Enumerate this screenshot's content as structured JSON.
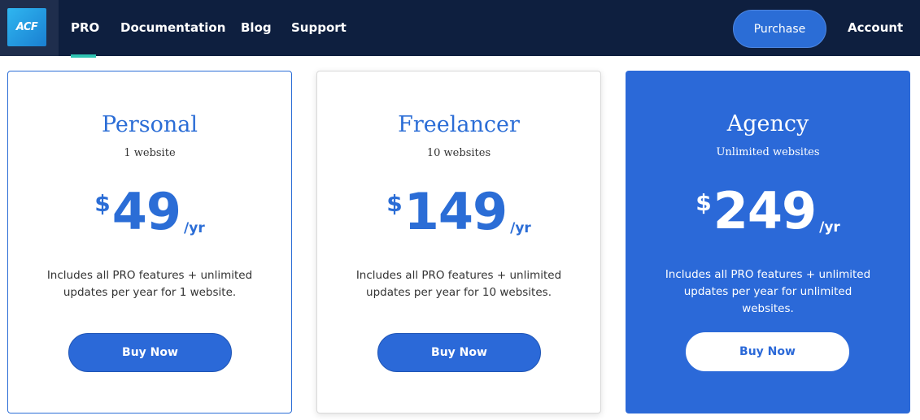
{
  "header": {
    "logo_text": "ACF",
    "nav": [
      {
        "label": "PRO"
      },
      {
        "label": "Documentation"
      },
      {
        "label": "Blog"
      },
      {
        "label": "Support"
      }
    ],
    "active_nav": "PRO",
    "purchase_label": "Purchase",
    "account_label": "Account"
  },
  "plans": [
    {
      "name": "Personal",
      "sites": "1 website",
      "currency": "$",
      "price": "49",
      "period": "/yr",
      "description": "Includes all PRO features + unlimited updates per year for 1 website.",
      "button": "Buy Now"
    },
    {
      "name": "Freelancer",
      "sites": "10 websites",
      "currency": "$",
      "price": "149",
      "period": "/yr",
      "description": "Includes all PRO features + unlimited updates per year for 10 websites.",
      "button": "Buy Now"
    },
    {
      "name": "Agency",
      "sites": "Unlimited websites",
      "currency": "$",
      "price": "249",
      "period": "/yr",
      "description": "Includes all PRO features + unlimited updates per year for unlimited websites.",
      "button": "Buy Now"
    }
  ],
  "colors": {
    "header_bg": "#0e1f3f",
    "brand_blue": "#2b6dd6",
    "active_indicator": "#2fc4b2"
  }
}
